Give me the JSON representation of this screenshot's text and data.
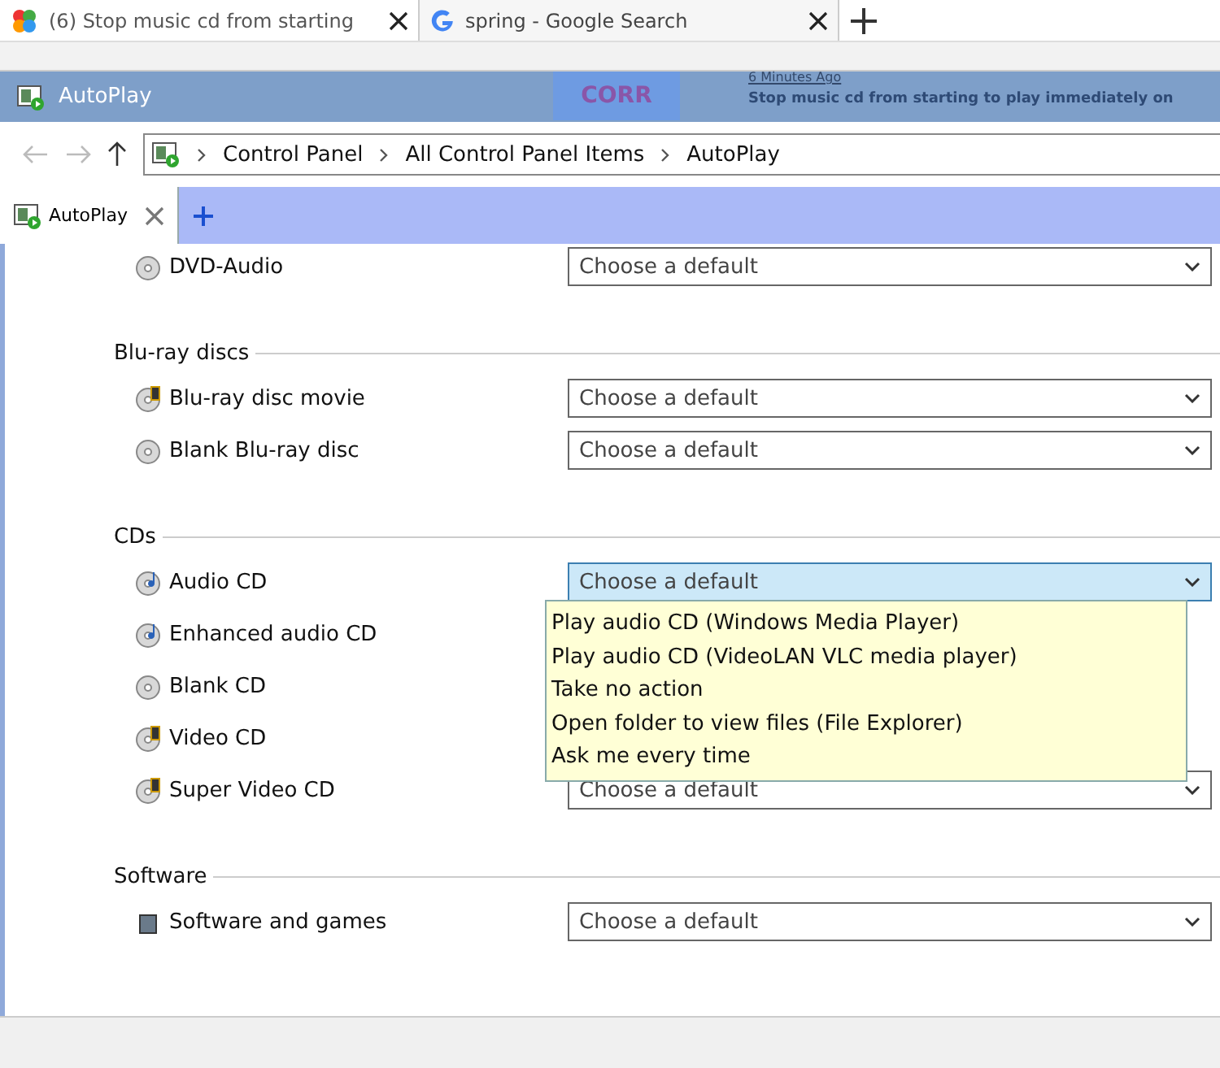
{
  "browser_tabs": [
    {
      "title": "(6) Stop music cd from starting",
      "kind": "forum",
      "selected": true
    },
    {
      "title": "spring - Google Search",
      "kind": "google",
      "selected": false
    }
  ],
  "background_page": {
    "badge": "CORR",
    "time": "6 Minutes Ago",
    "headline": "Stop music cd from starting to play immediately on"
  },
  "window": {
    "title": "AutoPlay"
  },
  "breadcrumb": [
    "Control Panel",
    "All Control Panel Items",
    "AutoPlay"
  ],
  "tabs": [
    {
      "label": "AutoPlay",
      "selected": true
    }
  ],
  "sections": [
    {
      "items": [
        {
          "label": "DVD-Audio",
          "kind": "disc",
          "value": "Choose a default",
          "expanded": false
        }
      ]
    },
    {
      "title": "Blu-ray discs",
      "items": [
        {
          "label": "Blu-ray disc movie",
          "kind": "video",
          "value": "Choose a default",
          "expanded": false
        },
        {
          "label": "Blank Blu-ray disc",
          "kind": "disc",
          "value": "Choose a default",
          "expanded": false
        }
      ]
    },
    {
      "title": "CDs",
      "items": [
        {
          "label": "Audio CD",
          "kind": "audio",
          "value": "Choose a default",
          "expanded": true,
          "options": [
            "Play audio CD (Windows Media Player)",
            "Play audio CD (VideoLAN VLC media player)",
            "Take no action",
            "Open folder to view files (File Explorer)",
            "Ask me every time"
          ]
        },
        {
          "label": "Enhanced audio CD",
          "kind": "audio"
        },
        {
          "label": "Blank CD",
          "kind": "disc"
        },
        {
          "label": "Video CD",
          "kind": "video"
        },
        {
          "label": "Super Video CD",
          "kind": "video",
          "value": "Choose a default",
          "expanded": false
        }
      ]
    },
    {
      "title": "Software",
      "items": [
        {
          "label": "Software and games",
          "kind": "software",
          "value": "Choose a default",
          "expanded": false
        }
      ]
    }
  ]
}
